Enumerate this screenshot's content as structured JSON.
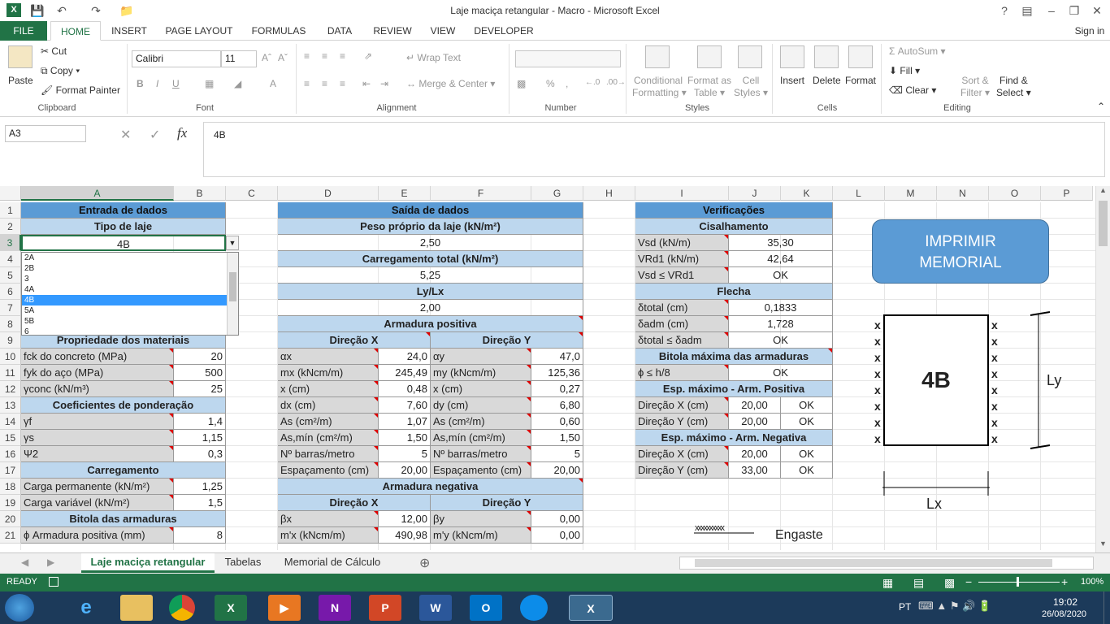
{
  "window": {
    "title": "Laje maciça retangular - Macro - Microsoft Excel",
    "help": "?",
    "signin": "Sign in"
  },
  "ribbon_tabs": [
    "FILE",
    "HOME",
    "INSERT",
    "PAGE LAYOUT",
    "FORMULAS",
    "DATA",
    "REVIEW",
    "VIEW",
    "DEVELOPER"
  ],
  "clipboard": {
    "paste": "Paste",
    "cut": "Cut",
    "copy": "Copy",
    "format_painter": "Format Painter",
    "group": "Clipboard"
  },
  "font": {
    "name": "Calibri",
    "size": "11",
    "group": "Font"
  },
  "alignment": {
    "wrap": "Wrap Text",
    "merge": "Merge & Center",
    "group": "Alignment"
  },
  "number": {
    "percent": "%",
    "group": "Number"
  },
  "styles": {
    "cond1": "Conditional",
    "cond2": "Formatting",
    "fmt1": "Format as",
    "fmt2": "Table",
    "cell1": "Cell",
    "cell2": "Styles",
    "group": "Styles"
  },
  "cells": {
    "insert": "Insert",
    "delete": "Delete",
    "format": "Format",
    "group": "Cells"
  },
  "editing": {
    "autosum": "AutoSum",
    "fill": "Fill",
    "clear": "Clear",
    "sort1": "Sort &",
    "sort2": "Filter",
    "find1": "Find &",
    "find2": "Select",
    "group": "Editing"
  },
  "formula_bar": {
    "namebox": "A3",
    "fx": "fx",
    "content": "4B"
  },
  "columns": [
    "A",
    "B",
    "C",
    "D",
    "E",
    "F",
    "G",
    "H",
    "I",
    "J",
    "K",
    "L",
    "M",
    "N",
    "O",
    "P"
  ],
  "rows": [
    "1",
    "2",
    "3",
    "4",
    "5",
    "6",
    "7",
    "8",
    "9",
    "10",
    "11",
    "12",
    "13",
    "14",
    "15",
    "16",
    "17",
    "18",
    "19",
    "20",
    "21"
  ],
  "left": {
    "title": "Entrada de dados",
    "tipo": "Tipo de laje",
    "tipo_value": "4B",
    "prop_title": "Propriedade dos materiais",
    "rows1": [
      [
        "fck do concreto (MPa)",
        "20"
      ],
      [
        "fyk do aço (MPa)",
        "500"
      ],
      [
        "γconc (kN/m³)",
        "25"
      ]
    ],
    "coef_title": "Coeficientes de ponderação",
    "rows2": [
      [
        "γf",
        "1,4"
      ],
      [
        "γs",
        "1,15"
      ],
      [
        "Ψ2",
        "0,3"
      ]
    ],
    "carr_title": "Carregamento",
    "rows3": [
      [
        "Carga permanente (kN/m²)",
        "1,25"
      ],
      [
        "Carga variável (kN/m²)",
        "1,5"
      ]
    ],
    "bitola_title": "Bitola das armaduras",
    "rows4": [
      [
        "ϕ Armadura positiva (mm)",
        "8"
      ]
    ]
  },
  "dropdown": {
    "options": [
      "2A",
      "2B",
      "3",
      "4A",
      "4B",
      "5A",
      "5B",
      "6"
    ],
    "selected": "4B"
  },
  "mid": {
    "title": "Saída de dados",
    "peso": "Peso próprio da laje (kN/m²)",
    "peso_v": "2,50",
    "carga": "Carregamento total (kN/m²)",
    "carga_v": "5,25",
    "lylx": "Ly/Lx",
    "lylx_v": "2,00",
    "arm_pos": "Armadura positiva",
    "dirx": "Direção X",
    "diry": "Direção Y",
    "pos_rows": [
      [
        "αx",
        "24,0",
        "αy",
        "47,0"
      ],
      [
        "mx (kNcm/m)",
        "245,49",
        "my (kNcm/m)",
        "125,36"
      ],
      [
        "x (cm)",
        "0,48",
        "x (cm)",
        "0,27"
      ],
      [
        "dx (cm)",
        "7,60",
        "dy (cm)",
        "6,80"
      ],
      [
        "As (cm²/m)",
        "1,07",
        "As (cm²/m)",
        "0,60"
      ],
      [
        "As,mín (cm²/m)",
        "1,50",
        "As,mín (cm²/m)",
        "1,50"
      ],
      [
        "Nº barras/metro",
        "5",
        "Nº barras/metro",
        "5"
      ],
      [
        "Espaçamento (cm)",
        "20,00",
        "Espaçamento (cm)",
        "20,00"
      ]
    ],
    "arm_neg": "Armadura negativa",
    "neg_rows": [
      [
        "βx",
        "12,00",
        "βy",
        "0,00"
      ],
      [
        "m'x (kNcm/m)",
        "490,98",
        "m'y (kNcm/m)",
        "0,00"
      ]
    ]
  },
  "right": {
    "title": "Verificações",
    "cis": "Cisalhamento",
    "cis_rows": [
      [
        "Vsd (kN/m)",
        "35,30"
      ],
      [
        "VRd1 (kN/m)",
        "42,64"
      ],
      [
        "Vsd ≤ VRd1",
        "OK"
      ]
    ],
    "flecha": "Flecha",
    "fle_rows": [
      [
        "δtotal (cm)",
        "0,1833"
      ],
      [
        "δadm (cm)",
        "1,728"
      ],
      [
        "δtotal ≤ δadm",
        "OK"
      ]
    ],
    "bitola": "Bitola máxima das armaduras",
    "bit_rows": [
      [
        "ϕ ≤ h/8",
        "OK"
      ]
    ],
    "esp_pos": "Esp. máximo - Arm. Positiva",
    "esp_pos_rows": [
      [
        "Direção X (cm)",
        "20,00",
        "OK"
      ],
      [
        "Direção Y (cm)",
        "20,00",
        "OK"
      ]
    ],
    "esp_neg": "Esp. máximo - Arm. Negativa",
    "esp_neg_rows": [
      [
        "Direção X (cm)",
        "20,00",
        "OK"
      ],
      [
        "Direção Y (cm)",
        "33,00",
        "OK"
      ]
    ]
  },
  "print_button": {
    "line1": "IMPRIMIR",
    "line2": "MEMORIAL"
  },
  "drawing": {
    "label": "4B",
    "ly": "Ly",
    "lx": "Lx",
    "engaste": "Engaste",
    "mark": "x"
  },
  "sheet_tabs": [
    "Laje maciça retangular",
    "Tabelas",
    "Memorial de Cálculo"
  ],
  "status": {
    "ready": "READY",
    "zoom": "100%"
  },
  "taskbar": {
    "lang": "PT",
    "time": "19:02",
    "date": "26/08/2020"
  }
}
